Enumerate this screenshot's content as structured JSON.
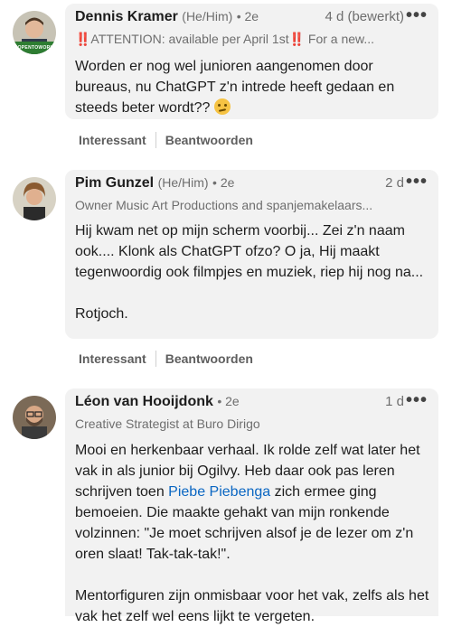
{
  "comments": [
    {
      "name": "Dennis Kramer",
      "pronoun": "(He/Him)",
      "degree": "• 2e",
      "time": "4 d (bewerkt)",
      "headline": "‼️ATTENTION: available per April 1st‼️ For a new...",
      "body": [
        "Worden er nog wel junioren aangenomen door bureaus, nu ChatGPT z'n intrede heeft gedaan en steeds beter wordt??"
      ],
      "avatar_badge": "#OPENTOWORK",
      "actions": [
        "Interessant",
        "Beantwoorden"
      ]
    },
    {
      "name": "Pim Gunzel",
      "pronoun": "(He/Him)",
      "degree": "• 2e",
      "time": "2 d",
      "headline": "Owner Music Art Productions and spanjemakelaars...",
      "body": [
        "Hij kwam net op mijn scherm voorbij... Zei z'n naam ook.... Klonk als ChatGPT ofzo? O ja, Hij maakt tegenwoordig ook filmpjes en muziek, riep hij nog na...",
        "Rotjoch."
      ],
      "actions": [
        "Interessant",
        "Beantwoorden"
      ]
    },
    {
      "name": "Léon van Hooijdonk",
      "degree": "• 2e",
      "time": "1 d",
      "headline": "Creative Strategist at Buro Dirigo",
      "body_pre": "Mooi en herkenbaar verhaal. Ik rolde zelf wat later het vak in als junior bij Ogilvy. Heb daar ook pas leren schrijven toen ",
      "body_link": "Piebe Piebenga",
      "body_post": " zich ermee ging bemoeien. Die maakte gehakt van mijn ronkende volzinnen: \"Je moet schrijven alsof je de lezer om z'n oren slaat! Tak-tak-tak!\".",
      "body_p2": "Mentorfiguren zijn onmisbaar voor het vak, zelfs als het vak het zelf wel eens lijkt te vergeten."
    }
  ],
  "icons": {
    "more": "more-dots-icon",
    "emoji": "thinking-face-icon"
  }
}
